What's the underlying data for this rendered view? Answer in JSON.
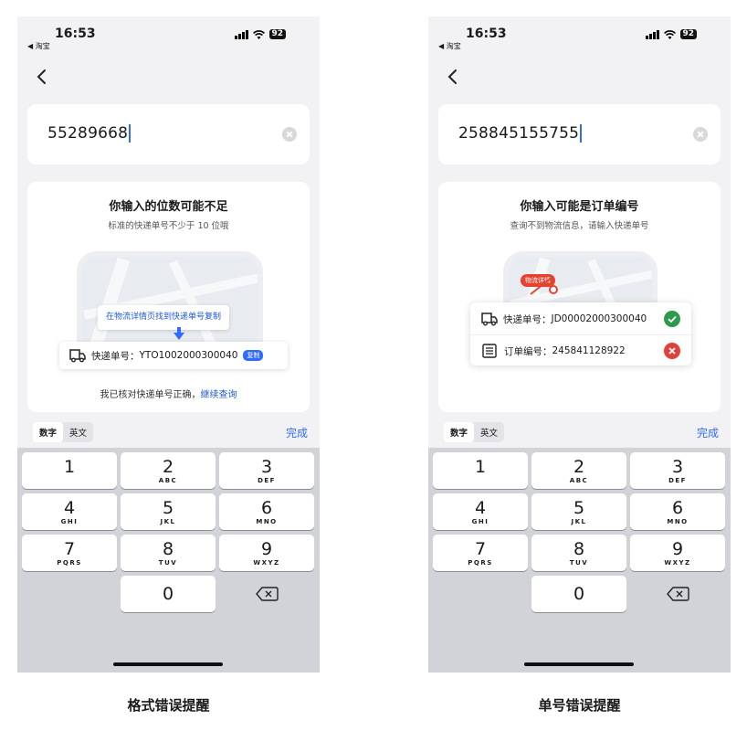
{
  "screens": [
    {
      "status": {
        "time": "16:53",
        "back_app": "◀ 淘宝",
        "battery": "92"
      },
      "input_value": "55289668",
      "tip_title": "你输入的位数可能不足",
      "tip_subtitle": "标准的快递单号不少于 10 位哦",
      "callout": "在物流详情页找到快递单号复制",
      "tracking_label": "快递单号：",
      "tracking_number": "YTO1002000300040",
      "copy_badge": "复制",
      "confirm_text": "我已核对快递单号正确，",
      "confirm_link": "继续查询",
      "caption": "格式错误提醒"
    },
    {
      "status": {
        "time": "16:53",
        "back_app": "◀ 淘宝",
        "battery": "92"
      },
      "input_value": "258845155755",
      "tip_title": "你输入可能是订单编号",
      "tip_subtitle": "查询不到物流信息，请输入快递单号",
      "map_label": "物流详情",
      "row1_label": "快递单号：",
      "row1_value": "JD00002000300040",
      "row2_label": "订单编号：",
      "row2_value": "245841128922",
      "caption": "单号错误提醒"
    }
  ],
  "keyboard": {
    "tabs": [
      "数字",
      "英文"
    ],
    "done": "完成",
    "keys": [
      {
        "num": "1",
        "letters": ""
      },
      {
        "num": "2",
        "letters": "ABC"
      },
      {
        "num": "3",
        "letters": "DEF"
      },
      {
        "num": "4",
        "letters": "GHI"
      },
      {
        "num": "5",
        "letters": "JKL"
      },
      {
        "num": "6",
        "letters": "MNO"
      },
      {
        "num": "7",
        "letters": "PQRS"
      },
      {
        "num": "8",
        "letters": "TUV"
      },
      {
        "num": "9",
        "letters": "WXYZ"
      },
      {
        "num": "0",
        "letters": ""
      }
    ]
  },
  "colors": {
    "accent": "#2f6bff",
    "success": "#2e9a4a",
    "error": "#e0413a"
  },
  "icons": [
    "chevron-left-icon",
    "clear-icon",
    "truck-icon",
    "list-icon",
    "check-circle-icon",
    "x-circle-icon",
    "delete-key-icon"
  ]
}
